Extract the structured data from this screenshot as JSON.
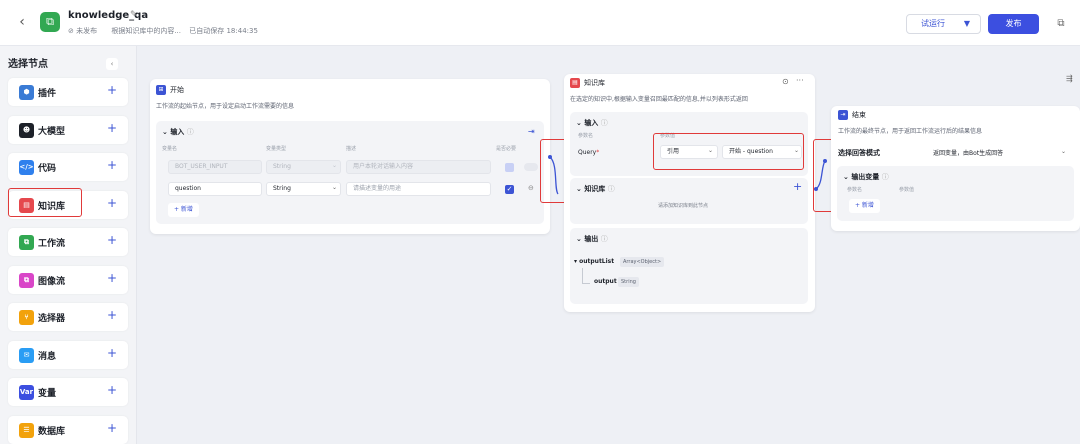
{
  "header": {
    "back_icon": "chevron-left-icon",
    "title": "knowledge_qa",
    "status": "未发布",
    "description": "根据知识库中的内容...",
    "autosave": "已自动保存 18:44:35",
    "run_label": "试运行",
    "publish_label": "发布"
  },
  "panel": {
    "title": "选择节点",
    "items": [
      {
        "label": "插件",
        "icon": "plugin-icon",
        "color": "#3a7bd5"
      },
      {
        "label": "大模型",
        "icon": "llm-icon",
        "color": "#1d2129"
      },
      {
        "label": "代码",
        "icon": "code-icon",
        "color": "#2f80ed"
      },
      {
        "label": "知识库",
        "icon": "knowledge-icon",
        "color": "#e5484d"
      },
      {
        "label": "工作流",
        "icon": "workflow-icon",
        "color": "#32a852"
      },
      {
        "label": "图像流",
        "icon": "imageflow-icon",
        "color": "#d946c8"
      },
      {
        "label": "选择器",
        "icon": "selector-icon",
        "color": "#f2a20c"
      },
      {
        "label": "消息",
        "icon": "message-icon",
        "color": "#2a9df4"
      },
      {
        "label": "变量",
        "icon": "variable-icon",
        "color": "#3c4fe0"
      },
      {
        "label": "数据库",
        "icon": "database-icon",
        "color": "#f2a20c"
      }
    ]
  },
  "start_node": {
    "title": "开始",
    "description": "工作流的起始节点，用于设定启动工作流需要的信息",
    "input_title": "输入",
    "col_name": "变量名",
    "col_type": "变量类型",
    "col_desc": "描述",
    "col_required": "是否必要",
    "rows": [
      {
        "name": "BOT_USER_INPUT",
        "type": "String",
        "desc": "用户本轮对话输入内容"
      },
      {
        "name": "question",
        "type": "String",
        "desc": "请描述变量的用途"
      }
    ],
    "add_label": "+ 新增"
  },
  "kb_node": {
    "title": "知识库",
    "description": "在选定的知识中,根据输入变量召回最匹配的信息,并以列表形式返回",
    "input_title": "输入",
    "col_name": "参数名",
    "col_value": "参数值",
    "param_name": "Query",
    "ref_label": "引用",
    "ref_value": "开始 - question",
    "kb_title": "知识库",
    "kb_placeholder": "请添加知识库到此节点",
    "output_title": "输出",
    "out_root": "outputList",
    "out_root_type": "Array<Object>",
    "out_child": "output",
    "out_child_type": "String"
  },
  "end_node": {
    "title": "结束",
    "description": "工作流的最终节点，用于返回工作流运行后的结果信息",
    "mode_label": "选择回答模式",
    "mode_value": "返回变量，由Bot生成回答",
    "output_title": "输出变量",
    "col_name": "参数名",
    "col_value": "参数值",
    "add_label": "+ 新增"
  }
}
